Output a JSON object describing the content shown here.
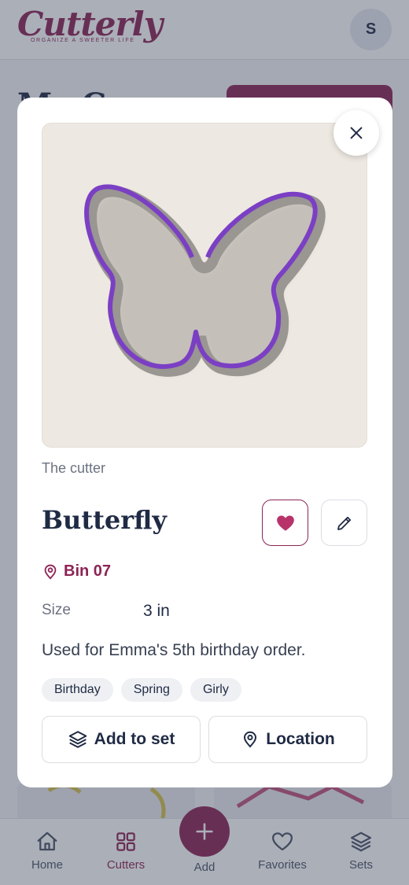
{
  "app": {
    "logo_text": "Cutterly",
    "tagline": "ORGANIZE A SWEETER LIFE",
    "user_initial": "S"
  },
  "nav": {
    "items": [
      {
        "label": "Home",
        "icon": "home-icon",
        "active": false
      },
      {
        "label": "Cutters",
        "icon": "grid-icon",
        "active": true
      },
      {
        "label": "Add",
        "icon": "plus-icon",
        "active": false
      },
      {
        "label": "Favorites",
        "icon": "heart-icon",
        "active": false
      },
      {
        "label": "Sets",
        "icon": "layers-icon",
        "active": false
      }
    ]
  },
  "modal": {
    "caption": "The cutter",
    "name": "Butterfly",
    "favorite": true,
    "bin": "Bin 07",
    "size_label": "Size",
    "size_value": "3 in",
    "notes": "Used for Emma's 5th birthday order.",
    "tags": [
      "Birthday",
      "Spring",
      "Girly"
    ],
    "add_to_set_label": "Add to set",
    "location_label": "Location"
  },
  "colors": {
    "brand": "#8c2455",
    "text": "#1f2a44",
    "cutter_purple": "#7b3fc4"
  }
}
